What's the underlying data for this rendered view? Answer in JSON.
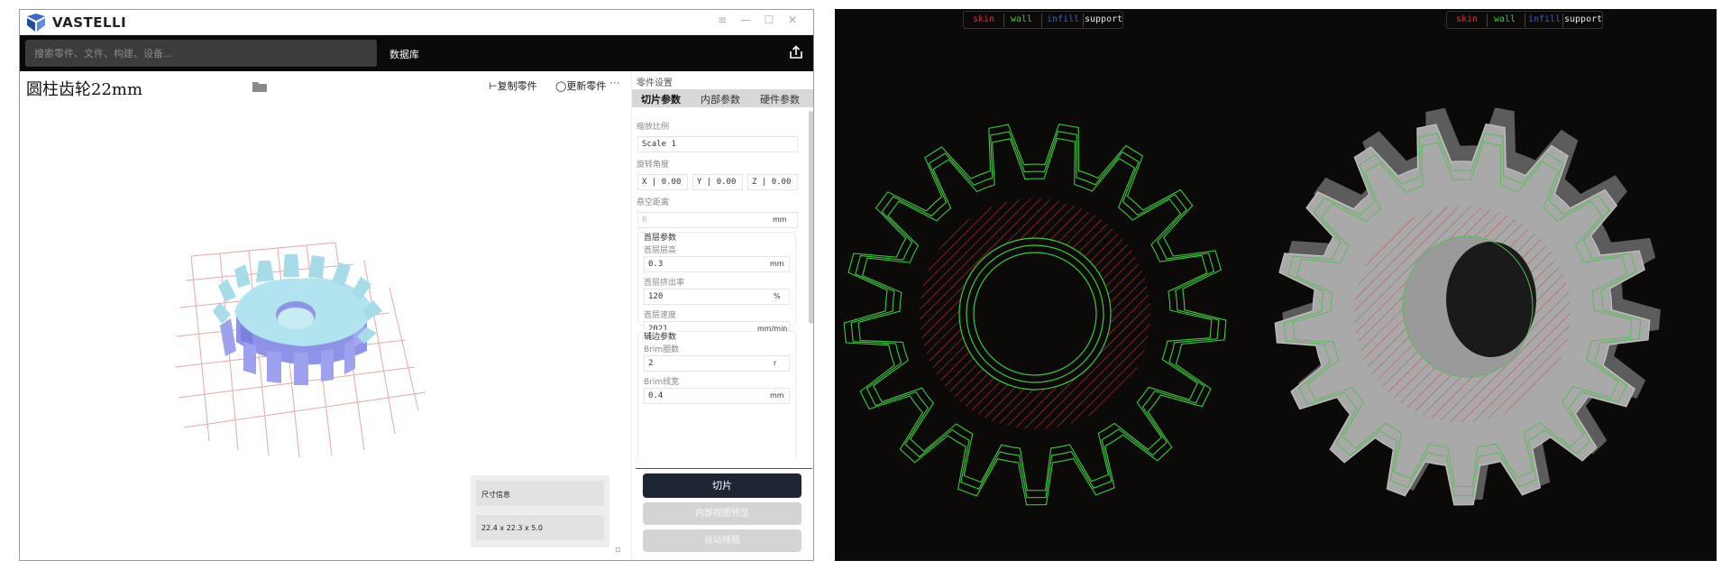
{
  "app": {
    "title": "VASTELLI",
    "win_menu": "≡",
    "win_min": "—",
    "win_max": "☐",
    "win_close": "✕"
  },
  "topbar": {
    "search_placeholder": "搜索零件、文件、构建、设备...",
    "nav_library": "数据库"
  },
  "viewport": {
    "part_title": "圆柱齿轮22mm",
    "copy_label": "复制零件",
    "update_label": "更新零件",
    "more_label": "···",
    "size_info_label": "尺寸信息",
    "size_info_value": "22.4 x 22.3 x 5.0"
  },
  "panel": {
    "title": "零件设置",
    "tabs": [
      "切片参数",
      "内部参数",
      "硬件参数"
    ],
    "scale_label": "缩放比例",
    "scale_value": "Scale 1",
    "rotate_label": "旋转角度",
    "rot_x_label": "X",
    "rot_x": "0.00",
    "rot_y_label": "Y",
    "rot_y": "0.00",
    "rot_z_label": "Z",
    "rot_z": "0.00",
    "hover_label": "悬空距离",
    "hover_value": "0",
    "hover_unit": "mm",
    "first_layer": {
      "title": "首层参数",
      "height_label": "首层层高",
      "height_value": "0.3",
      "height_unit": "mm",
      "extrude_label": "首层挤出率",
      "extrude_value": "120",
      "extrude_unit": "%",
      "speed_label": "首层速度",
      "speed_value": "2021",
      "speed_unit": "mm/min"
    },
    "brim": {
      "title": "辅边参数",
      "count_label": "Brim圈数",
      "count_value": "2",
      "count_unit": "r",
      "width_label": "Brim线宽",
      "width_value": "0.4",
      "width_unit": "mm"
    },
    "slice_button": "切片",
    "preview_button": "内部视图预览",
    "arrange_button": "自动排版"
  },
  "legend": {
    "skin": "skin",
    "wall": "wall",
    "infill": "infill",
    "support": "support",
    "colors": {
      "skin": "#e03030",
      "wall": "#3ec93e",
      "infill": "#3a5fd0",
      "support": "#e8e8e8"
    }
  }
}
